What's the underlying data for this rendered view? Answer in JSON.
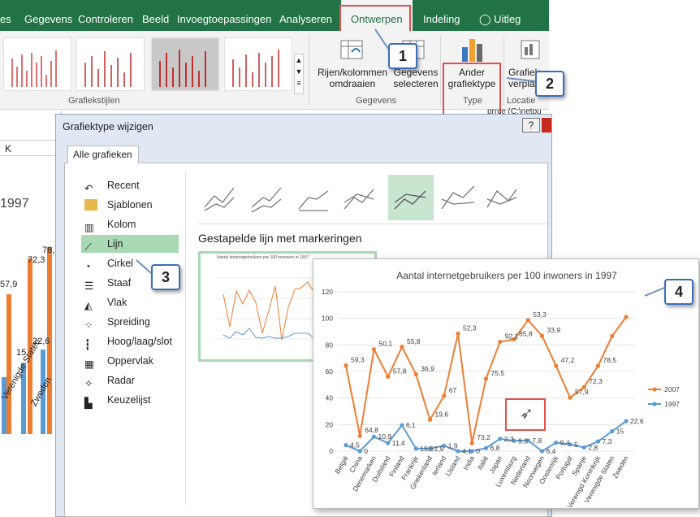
{
  "ribbon": {
    "tabs": [
      "es",
      "Gegevens",
      "Controleren",
      "Beeld",
      "Invoegtoepassingen",
      "Analyseren",
      "Ontwerpen",
      "Indeling",
      "Uitleg"
    ],
    "buttons": {
      "switch": "Rijen/kolommen omdraaien",
      "select": "Gegevens selecteren",
      "change_type": "Ander grafiektype",
      "move": "Grafiek verplaatsen"
    },
    "groups": {
      "styles": "Grafiekstijlen",
      "data": "Gegevens",
      "type": "Type",
      "location": "Locatie"
    }
  },
  "sheet": {
    "col": "K",
    "year": "1997",
    "values": [
      "78,5",
      "57,9",
      "72,3",
      "15",
      "22,6"
    ],
    "categories": [
      "rijk",
      "Verenigde Staten",
      "Zweden"
    ],
    "cell_fragment": "prrce (C:\\netpu"
  },
  "dialog": {
    "title": "Grafiektype wijzigen",
    "help": "?",
    "tab": "Alle grafieken",
    "categories": [
      "Recent",
      "Sjablonen",
      "Kolom",
      "Lijn",
      "Cirkel",
      "Staaf",
      "Vlak",
      "Spreiding",
      "Hoog/laag/slot",
      "Oppervlak",
      "Radar",
      "Keuzelijst"
    ],
    "selected_category": "Lijn",
    "subtype_title": "Gestapelde lijn met markeringen",
    "preview_title": "Aantal internetgebruikers per 100 inwoners in 1997"
  },
  "callouts": [
    "1",
    "2",
    "3",
    "4"
  ],
  "chart_data": {
    "type": "line",
    "title": "Aantal internetgebruikers  per 100 inwoners  in 1997",
    "categories": [
      "België",
      "China",
      "Denemarken",
      "Duitsland",
      "Finland",
      "Frankrijk",
      "Griekenland",
      "Ierland",
      "IJsland",
      "India",
      "Italië",
      "Japan",
      "Luxemburg",
      "Nederland",
      "Noorwegen",
      "Oostenrijk",
      "Portugal",
      "Spanje",
      "Verenigd Koninkrijk",
      "Verenigde Staten",
      "Zweden"
    ],
    "series": [
      {
        "name": "2007",
        "color": "#ed7d31",
        "values": [
          64.5,
          11.5,
          76.7,
          56.1,
          78.5,
          57.8,
          23.7,
          41.6,
          88.5,
          6,
          54.6,
          82.3,
          84.2,
          98.7,
          86.8,
          64.2,
          40.3,
          48.3,
          64.3,
          86.7,
          101.1
        ]
      },
      {
        "name": "1997",
        "color": "#5b9bd5",
        "values": [
          4.5,
          0,
          10.9,
          6.1,
          19.5,
          1.9,
          1.9,
          4.1,
          0,
          0,
          2.3,
          9.3,
          7.8,
          8,
          0,
          6.4,
          5,
          2.8,
          7.3,
          15,
          22.6
        ]
      }
    ],
    "labels_2007": [
      "59,3",
      "",
      "64,8",
      "50,1",
      "57,8",
      "55,8",
      "",
      "36,9",
      "19,6",
      "67",
      "52,3",
      "73,2",
      "75,5",
      "",
      "92,1",
      "85,8",
      "53,3",
      "33,9",
      "47,2",
      "57,9",
      "72,3",
      "78,5"
    ],
    "labels_1997": [
      "4,5",
      "0",
      "10,9",
      "11,4",
      "6,1",
      "19,5",
      "1,9",
      "1,9",
      "4,1",
      "0",
      "6,8",
      "2,3",
      "9,3",
      "7,8",
      "",
      "6,4",
      "9,4",
      "5",
      "2,8",
      "7,3",
      "15",
      "22,6"
    ],
    "ylim": [
      0,
      120
    ],
    "yticks": [
      0,
      20,
      40,
      60,
      80,
      100,
      120
    ],
    "legend": "right"
  }
}
